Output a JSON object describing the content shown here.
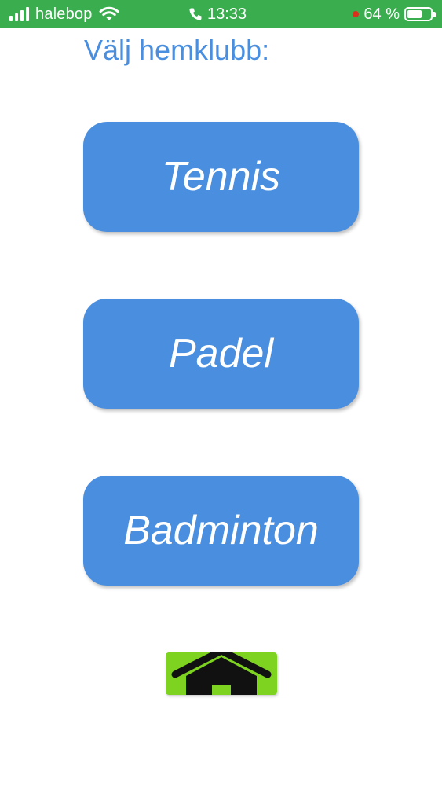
{
  "status_bar": {
    "carrier": "halebop",
    "time": "13:33",
    "battery_percent": "64 %",
    "battery_level": 0.64,
    "background_color": "#3aae4e",
    "icons": [
      "signal-bars-icon",
      "wifi-icon",
      "phone-icon",
      "recording-dot-icon",
      "battery-icon"
    ]
  },
  "page": {
    "title": "Välj hemklubb:"
  },
  "clubs": [
    {
      "label": "Tennis"
    },
    {
      "label": "Padel"
    },
    {
      "label": "Badminton"
    }
  ],
  "home_button": {
    "icon": "home-icon",
    "background_color": "#7ed321"
  },
  "colors": {
    "accent": "#4a8fdf",
    "button_text": "#ffffff"
  }
}
